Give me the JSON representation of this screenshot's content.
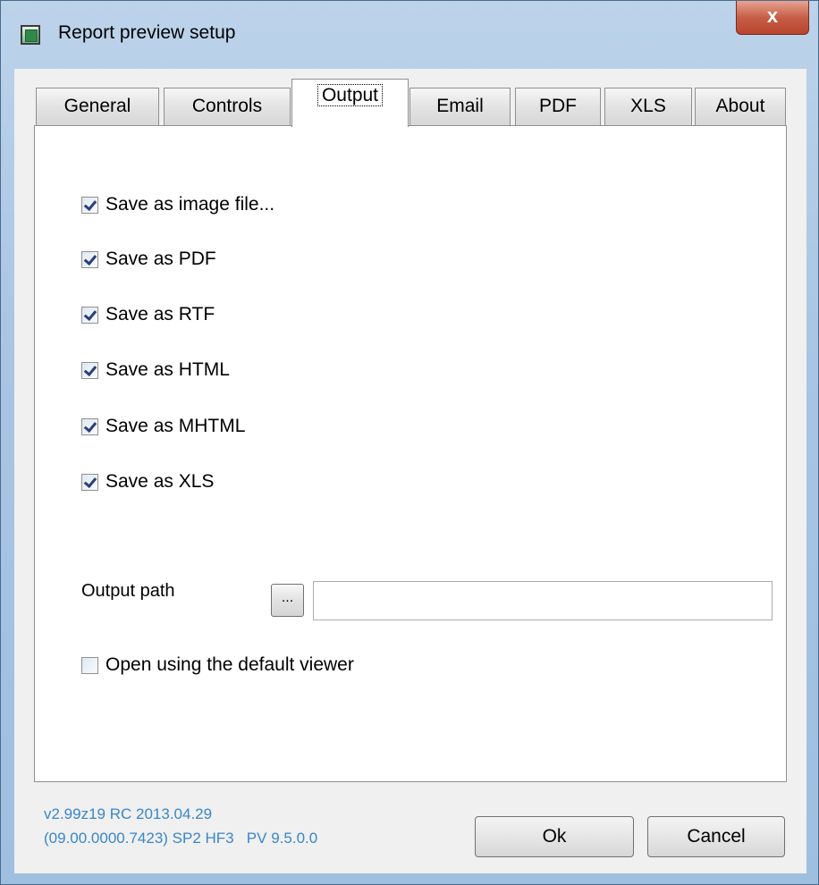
{
  "window": {
    "title": "Report preview setup",
    "close_label": "x"
  },
  "tabs": [
    {
      "label": "General",
      "active": false
    },
    {
      "label": "Controls",
      "active": false
    },
    {
      "label": "Output",
      "active": true
    },
    {
      "label": "Email",
      "active": false
    },
    {
      "label": "PDF",
      "active": false
    },
    {
      "label": "XLS",
      "active": false
    },
    {
      "label": "About",
      "active": false
    }
  ],
  "output": {
    "options": [
      {
        "label": "Save as image file...",
        "checked": true
      },
      {
        "label": "Save as PDF",
        "checked": true
      },
      {
        "label": "Save as RTF",
        "checked": true
      },
      {
        "label": "Save as HTML",
        "checked": true
      },
      {
        "label": "Save as MHTML",
        "checked": true
      },
      {
        "label": "Save as XLS",
        "checked": true
      }
    ],
    "path_label": "Output path",
    "browse_label": "...",
    "path_value": "",
    "open_viewer": {
      "label": "Open using the default viewer",
      "checked": false
    }
  },
  "footer": {
    "version_line1": "v2.99z19 RC 2013.04.29",
    "version_line2": "(09.00.0000.7423) SP2 HF3   PV 9.5.0.0",
    "ok_label": "Ok",
    "cancel_label": "Cancel"
  },
  "colors": {
    "version_text": "#3a86c8",
    "close_button": "#c75e47",
    "frame": "#a9c5e3"
  }
}
